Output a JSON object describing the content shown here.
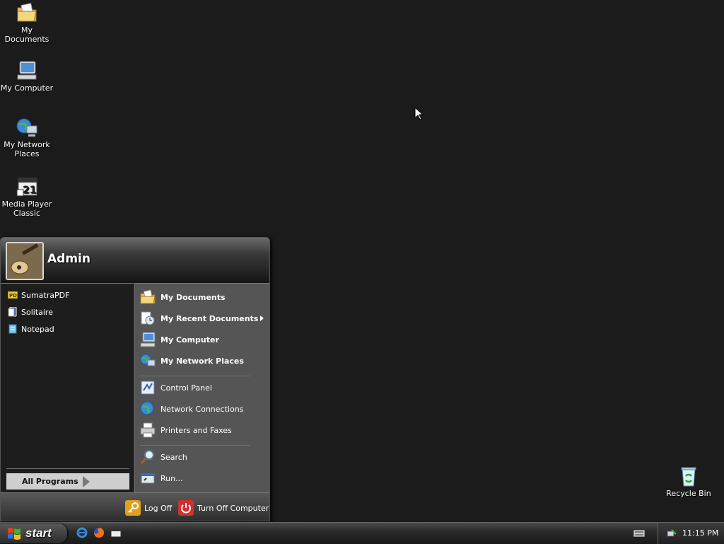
{
  "desktop": {
    "icons": [
      {
        "label": "My Documents",
        "icon": "folder-documents-icon"
      },
      {
        "label": "My Computer",
        "icon": "computer-icon"
      },
      {
        "label": "My Network Places",
        "icon": "network-places-icon"
      },
      {
        "label": "Media Player Classic",
        "icon": "media-player-icon"
      },
      {
        "label": "Recycle Bin",
        "icon": "recycle-bin-icon"
      }
    ]
  },
  "start_menu": {
    "username": "Admin",
    "pinned": [
      {
        "label": "SumatraPDF",
        "icon": "sumatrapdf-icon"
      },
      {
        "label": "Solitaire",
        "icon": "solitaire-icon"
      },
      {
        "label": "Notepad",
        "icon": "notepad-icon"
      }
    ],
    "all_programs": "All Programs",
    "places": [
      {
        "label": "My Documents",
        "icon": "my-documents-icon"
      },
      {
        "label": "My Recent Documents",
        "icon": "recent-documents-icon"
      },
      {
        "label": "My Computer",
        "icon": "my-computer-icon"
      },
      {
        "label": "My Network Places",
        "icon": "my-network-places-icon"
      }
    ],
    "settings": [
      {
        "label": "Control Panel",
        "icon": "control-panel-icon"
      },
      {
        "label": "Network Connections",
        "icon": "network-connections-icon"
      },
      {
        "label": "Printers and Faxes",
        "icon": "printers-icon"
      }
    ],
    "tools": [
      {
        "label": "Search",
        "icon": "search-icon"
      },
      {
        "label": "Run...",
        "icon": "run-icon"
      }
    ],
    "log_off": "Log Off",
    "turn_off": "Turn Off Computer"
  },
  "taskbar": {
    "start_label": "start",
    "clock": "11:15 PM"
  },
  "colors": {
    "desktop": "#1b1b1b",
    "menu_left": "#1d1d1d",
    "menu_right": "#555555",
    "log_off": "#e0a020",
    "turn_off": "#d03030"
  }
}
